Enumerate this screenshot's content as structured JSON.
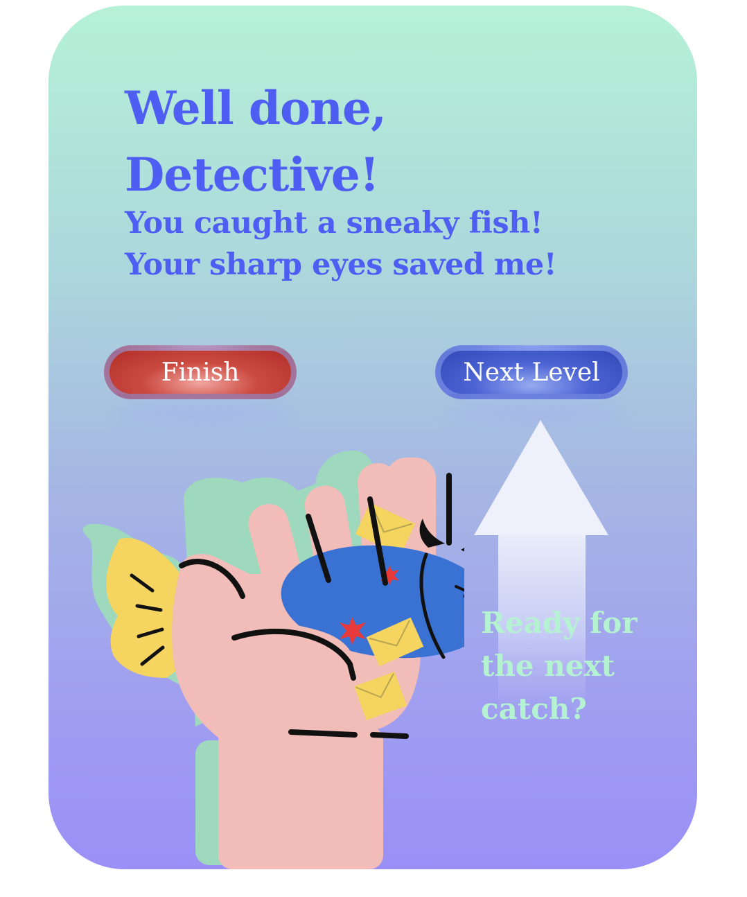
{
  "screen": {
    "title_line1": "Well done,",
    "title_line2": "Detective!",
    "subtitle_line1": "You caught a sneaky fish!",
    "subtitle_line2": "Your sharp eyes saved me!"
  },
  "buttons": {
    "finish_label": "Finish",
    "next_label": "Next Level"
  },
  "prompt": {
    "line1": "Ready for",
    "line2": "the next",
    "line3": "catch?"
  },
  "illustration": {
    "subject": "hand holding a devil fish with envelopes",
    "icons": [
      "hand-icon",
      "devil-fish-icon",
      "envelope-icon",
      "up-arrow-icon"
    ]
  },
  "colors": {
    "title": "#4f5ef2",
    "finish_button": "#c0392b",
    "next_button": "#3f56c6",
    "prompt_text": "#b4f2d2",
    "background_top": "#b5f1d7",
    "background_bottom": "#9a8ff6"
  }
}
